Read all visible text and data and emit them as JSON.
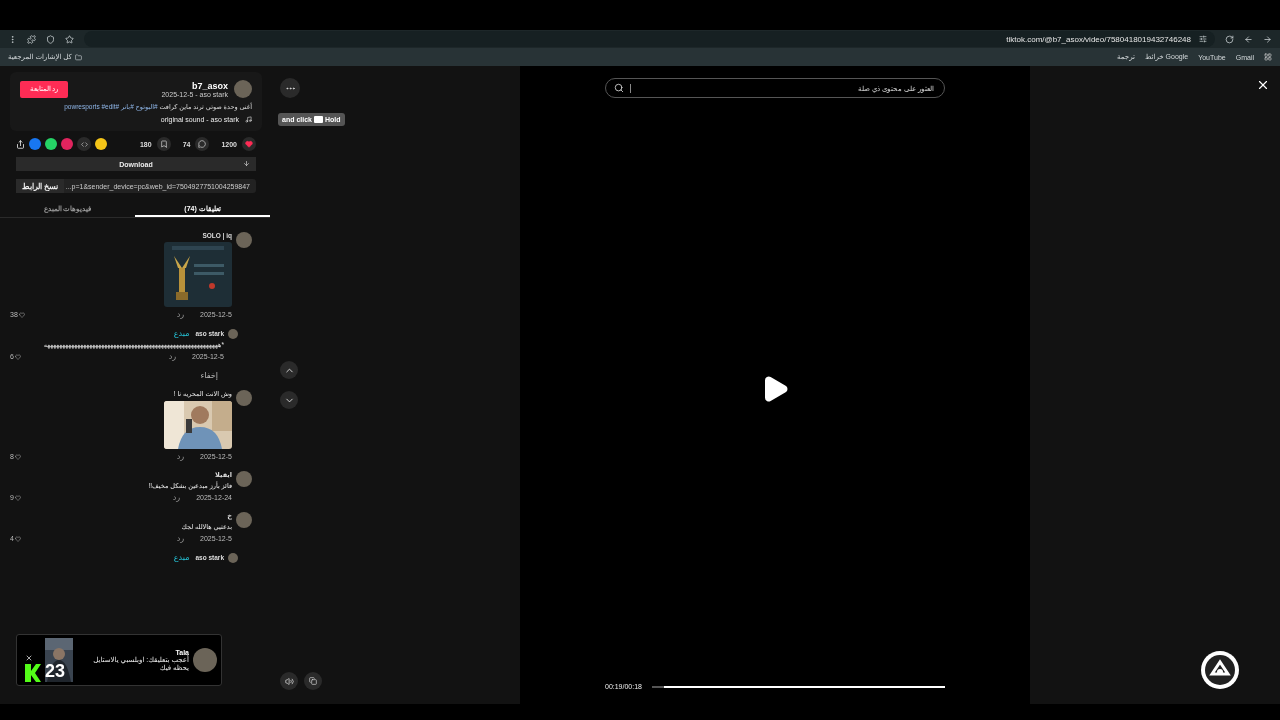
{
  "browser": {
    "url": "tiktok.com/@b7_asox/video/7580418019432746248",
    "bookmarks_left": [
      {
        "label": "كل الإشارات المرجعية"
      }
    ],
    "bookmarks_right": [
      {
        "label": "Gmail"
      },
      {
        "label": "YouTube"
      },
      {
        "label": "خرائط Google"
      },
      {
        "label": "ترجمة"
      }
    ]
  },
  "post": {
    "author": "b7_asox",
    "subtitle": "2025-12-5 - aso stark",
    "follow_button": "رد المتابعة",
    "description": "أغنى وحدة صوتي ترند ماين كرافت",
    "hashtags": "#البوتوح #بانر #powresports #edit",
    "sound": "original sound - aso stark"
  },
  "actions": [
    {
      "kind": "like",
      "count": "1200",
      "selected": true
    },
    {
      "kind": "comment",
      "count": "74",
      "selected": false
    },
    {
      "kind": "save",
      "count": "180",
      "selected": false
    }
  ],
  "download": "Download",
  "link": {
    "value": "...p=1&sender_device=pc&web_id=7504927751004259847",
    "button": "نسخ الرابط"
  },
  "tabs": [
    {
      "label": "تعليقات (74)",
      "selected": true
    },
    {
      "label": "فيديوهات المبدع",
      "selected": false
    }
  ],
  "comments": [
    {
      "kind": "comment",
      "author": "SOLO | iq",
      "picture": true,
      "date": "2025-12-5",
      "reply": "رد",
      "likes": "38"
    },
    {
      "kind": "reply",
      "author": "aso stark",
      "badge": "مبدع",
      "text": "*ههههههههههههههههههههههههههههههههههههههههههههههههههههههههههه",
      "date": "2025-12-5",
      "reply": "رد",
      "likes": "6"
    },
    {
      "kind": "hide",
      "label": "إخفاء"
    },
    {
      "kind": "comment",
      "text": "وش الانت المحريه نا !",
      "picture": true,
      "date": "2025-12-5",
      "reply": "رد",
      "likes": "8"
    },
    {
      "kind": "comment",
      "author": "ايفيلا",
      "text": "فائز بأرز مبدعين بشكل مخيف!!",
      "date": "2025-12-24",
      "reply": "رد",
      "likes": "9"
    },
    {
      "kind": "comment",
      "author": "خ",
      "text": "بدعتيي هالالله لجك",
      "date": "2025-12-5",
      "reply": "رد",
      "likes": "4"
    },
    {
      "kind": "reply",
      "author": "aso stark",
      "badge": "مبدع"
    }
  ],
  "toast": {
    "name": "Tala",
    "message": "أعجب بتعليقك: اوبلسبي يالاستايل يحظه فيك",
    "count": "23"
  },
  "player": {
    "search_placeholder": "العثور على محتوى ذي صلة",
    "time": "00:19/00:18",
    "level": 0.96,
    "tooltip_before": "and click",
    "tooltip_after": "Hold"
  }
}
